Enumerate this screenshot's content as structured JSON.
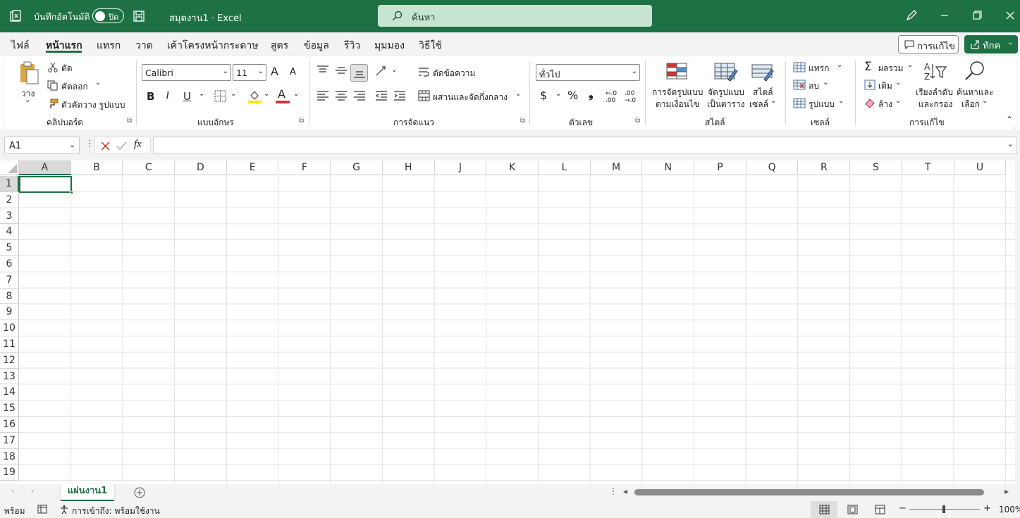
{
  "title_bar": {
    "app_icon": "excel-file-icon",
    "autosave_label": "บันทึกอัตโนมัติ",
    "autosave_state": "ปิด",
    "save_icon": "save-icon",
    "doc_title": "สมุดงาน1 · Excel",
    "search_placeholder": "ค้นหา",
    "icons": [
      "pen-icon",
      "minimize-icon",
      "restore-icon",
      "close-icon"
    ]
  },
  "tabs": [
    {
      "label": "ไฟล์",
      "active": false
    },
    {
      "label": "หน้าแรก",
      "active": true
    },
    {
      "label": "แทรก",
      "active": false
    },
    {
      "label": "วาด",
      "active": false
    },
    {
      "label": "เค้าโครงหน้ากระดาษ",
      "active": false
    },
    {
      "label": "สูตร",
      "active": false
    },
    {
      "label": "ข้อมูล",
      "active": false
    },
    {
      "label": "รีวิว",
      "active": false
    },
    {
      "label": "มุมมอง",
      "active": false
    },
    {
      "label": "วิธีใช้",
      "active": false
    }
  ],
  "editing_button": "การแก้ไข",
  "share_button": "ทักค",
  "ribbon": {
    "clipboard": {
      "paste": "วาง",
      "cut": "ตัด",
      "copy": "คัดลอก",
      "format_painter": "ตัวคัดวาง รูปแบบ",
      "group": "คลิปบอร์ด"
    },
    "font": {
      "name": "Calibri",
      "size": "11",
      "bold": "B",
      "italic": "I",
      "underline": "U",
      "grow": "A",
      "shrink": "A",
      "font_color": "A",
      "group": "แบบอักษร",
      "highlight_color": "#ffe600",
      "text_color": "#d13438"
    },
    "alignment": {
      "wrap": "ตัดข้อความ",
      "merge": "ผสานและจัดกึ่งกลาง",
      "group": "การจัดแนว"
    },
    "number": {
      "format": "ทั่วไป",
      "currency": "$",
      "percent": "%",
      "comma": "❟",
      "inc_decimal": "←.0 .00",
      "dec_decimal": ".00 →.0",
      "group": "ตัวเลข"
    },
    "styles": {
      "conditional_1": "การจัดรูปแบบ",
      "conditional_2": "ตามเงื่อนไข",
      "table_1": "จัดรูปแบบ",
      "table_2": "เป็นตาราง",
      "cell_1": "สไตล์",
      "cell_2": "เซลล์",
      "group": "สไตล์"
    },
    "cells": {
      "insert": "แทรก",
      "delete": "ลบ",
      "format": "รูปแบบ",
      "group": "เซลล์"
    },
    "editing": {
      "autosum": "ผลรวม",
      "fill": "เติม",
      "clear": "ล้าง",
      "sort_1": "เรียงลำดับ",
      "sort_2": "และกรอง",
      "find_1": "ค้นหาและ",
      "find_2": "เลือก",
      "group": "การแก้ไข"
    }
  },
  "formula_bar": {
    "name_box": "A1",
    "fx": "fx",
    "value": ""
  },
  "columns": [
    "A",
    "B",
    "C",
    "D",
    "E",
    "F",
    "G",
    "H",
    "J",
    "K",
    "L",
    "M",
    "N",
    "P",
    "Q",
    "R",
    "S",
    "T",
    "U"
  ],
  "rows": [
    "1",
    "2",
    "3",
    "4",
    "5",
    "6",
    "7",
    "8",
    "9",
    "10",
    "11",
    "12",
    "13",
    "14",
    "15",
    "16",
    "17",
    "18",
    "19"
  ],
  "sheet_tab": "แผ่นงาน1",
  "status": {
    "ready": "พร้อม",
    "accessibility": "การเข้าถึง: พร้อมใช้งาน",
    "zoom": "100%"
  },
  "colors": {
    "accent": "#1e7145",
    "search_bg": "#c7e4d2"
  }
}
